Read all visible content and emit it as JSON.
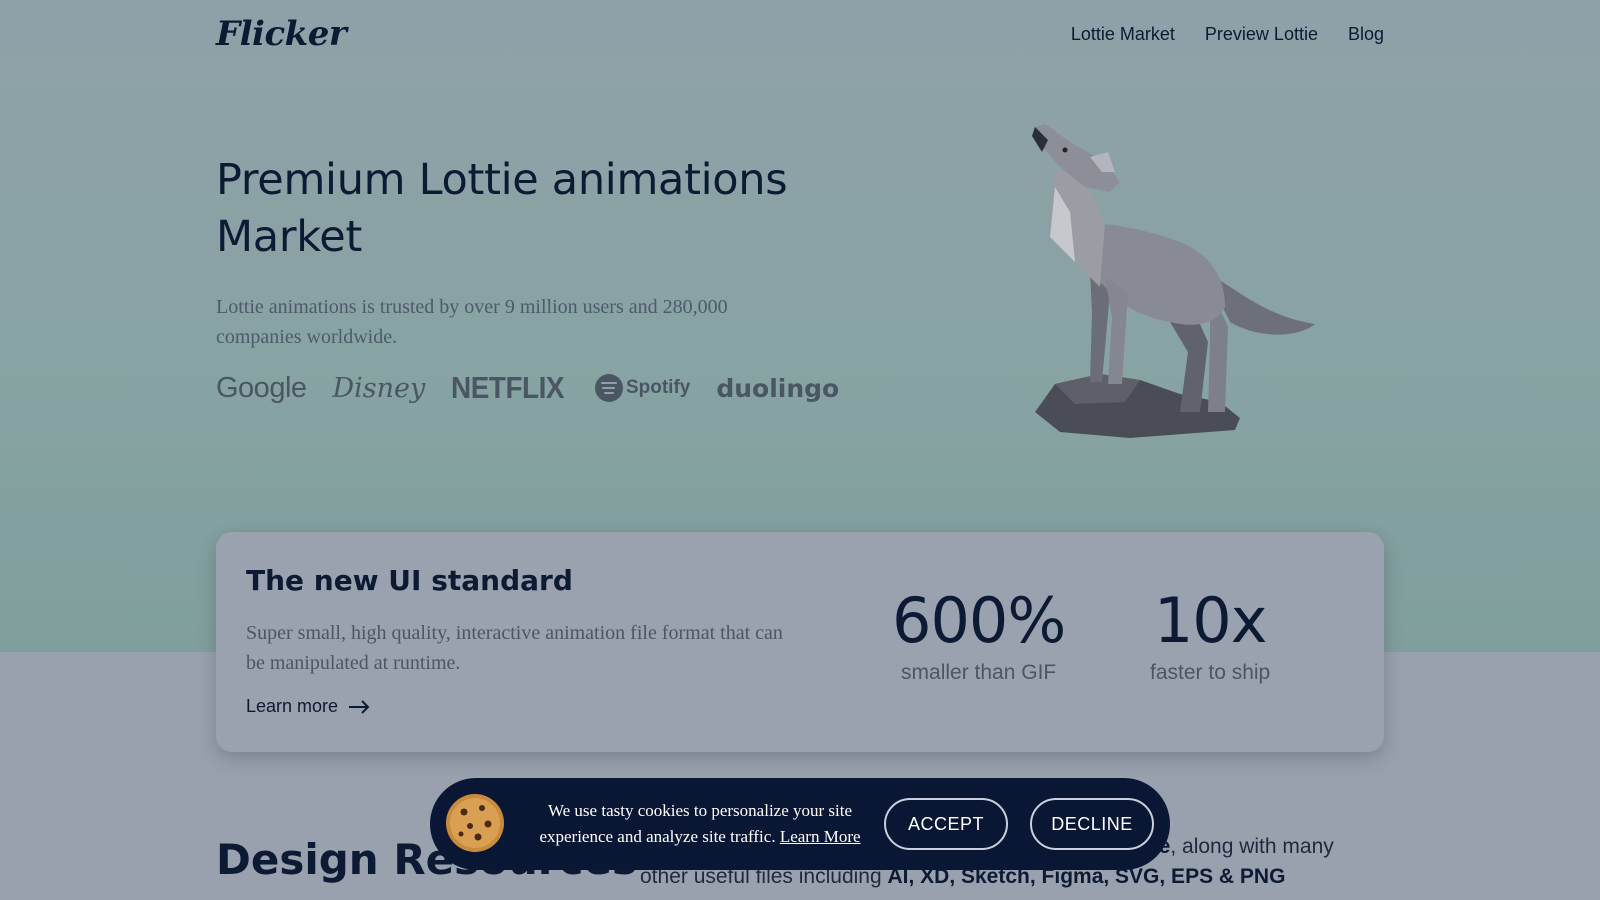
{
  "nav": {
    "logo": "Flicker",
    "links": [
      "Lottie Market",
      "Preview Lottie",
      "Blog"
    ]
  },
  "hero": {
    "title": "Premium Lottie animations Market",
    "subtitle": "Lottie animations is trusted by over 9 million users and 280,000 companies worldwide.",
    "brands": [
      "Google",
      "Disney",
      "NETFLIX",
      "Spotify",
      "duolingo"
    ]
  },
  "card": {
    "title": "The new UI standard",
    "text": "Super small, high quality, interactive animation file format that can be manipulated at runtime.",
    "learn_more": "Learn more",
    "stats": [
      {
        "value": "600%",
        "label": "smaller than GIF"
      },
      {
        "value": "10x",
        "label": "faster to ship"
      }
    ]
  },
  "design": {
    "title": "Design Resources",
    "text_part1": "file",
    "text_part2": ", along with many",
    "text_part3": "other useful files including ",
    "text_bold": "AI, XD, Sketch, Figma, SVG, EPS & PNG"
  },
  "cookie": {
    "text": "We use tasty cookies to personalize your site experience and analyze site traffic.",
    "learn_more": "Learn More",
    "accept": "ACCEPT",
    "decline": "DECLINE"
  },
  "colors": {
    "navy": "#0a1734",
    "text": "#0c1a33",
    "muted": "#4b5666"
  }
}
